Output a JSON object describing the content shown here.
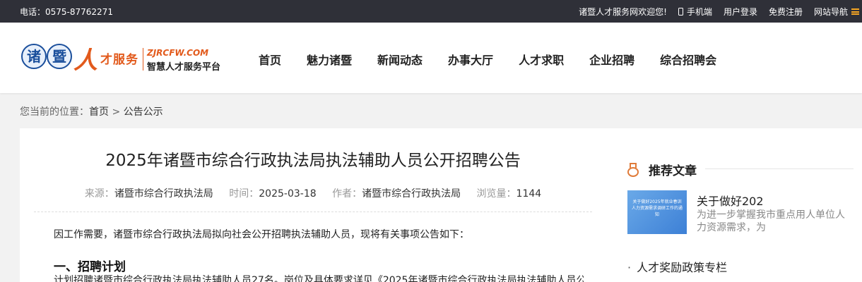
{
  "topbar": {
    "phone": "电话：0575-87762271",
    "welcome": "诸暨人才服务网欢迎您!",
    "mobile": "手机端",
    "login": "用户登录",
    "register": "免费注册",
    "sitenav": "网站导航",
    "accent": "#f5a623"
  },
  "logo": {
    "seal1": "诸",
    "seal2": "暨",
    "ren": "人",
    "cai": "才服务",
    "en": "ZJRCFW.COM",
    "sub": "智慧人才服务平台"
  },
  "nav": {
    "items": [
      "首页",
      "魅力诸暨",
      "新闻动态",
      "办事大厅",
      "人才求职",
      "企业招聘",
      "综合招聘会"
    ]
  },
  "breadcrumb": {
    "prefix": "您当前的位置：",
    "home": "首页",
    "sep": ">",
    "current": "公告公示"
  },
  "article": {
    "title": "2025年诸暨市综合行政执法局执法辅助人员公开招聘公告",
    "source_label": "来源：",
    "source": "诸暨市综合行政执法局",
    "time_label": "时间：",
    "time": "2025-03-18",
    "author_label": "作者：",
    "author": "诸暨市综合行政执法局",
    "views_label": "浏览量：",
    "views": "1144",
    "intro": "因工作需要，诸暨市综合行政执法局拟向社会公开招聘执法辅助人员，现将有关事项公告如下：",
    "section1": "一、招聘计划",
    "para1": "计划招聘诸暨市综合行政执法局执法辅助人员27名。岗位及具体要求详见《2025年诸暨市综合行政执法局执法辅助人员公"
  },
  "sidebar": {
    "heading": "推荐文章",
    "rec_thumb_text": "关于做好2025年就业春训人力资源需求调研工作的通知",
    "rec_title": "关于做好202",
    "rec_desc": "为进一步掌握我市重点用人单位人力资源需求，为",
    "link1": "人才奖励政策专栏",
    "accent": "#e07b39"
  }
}
